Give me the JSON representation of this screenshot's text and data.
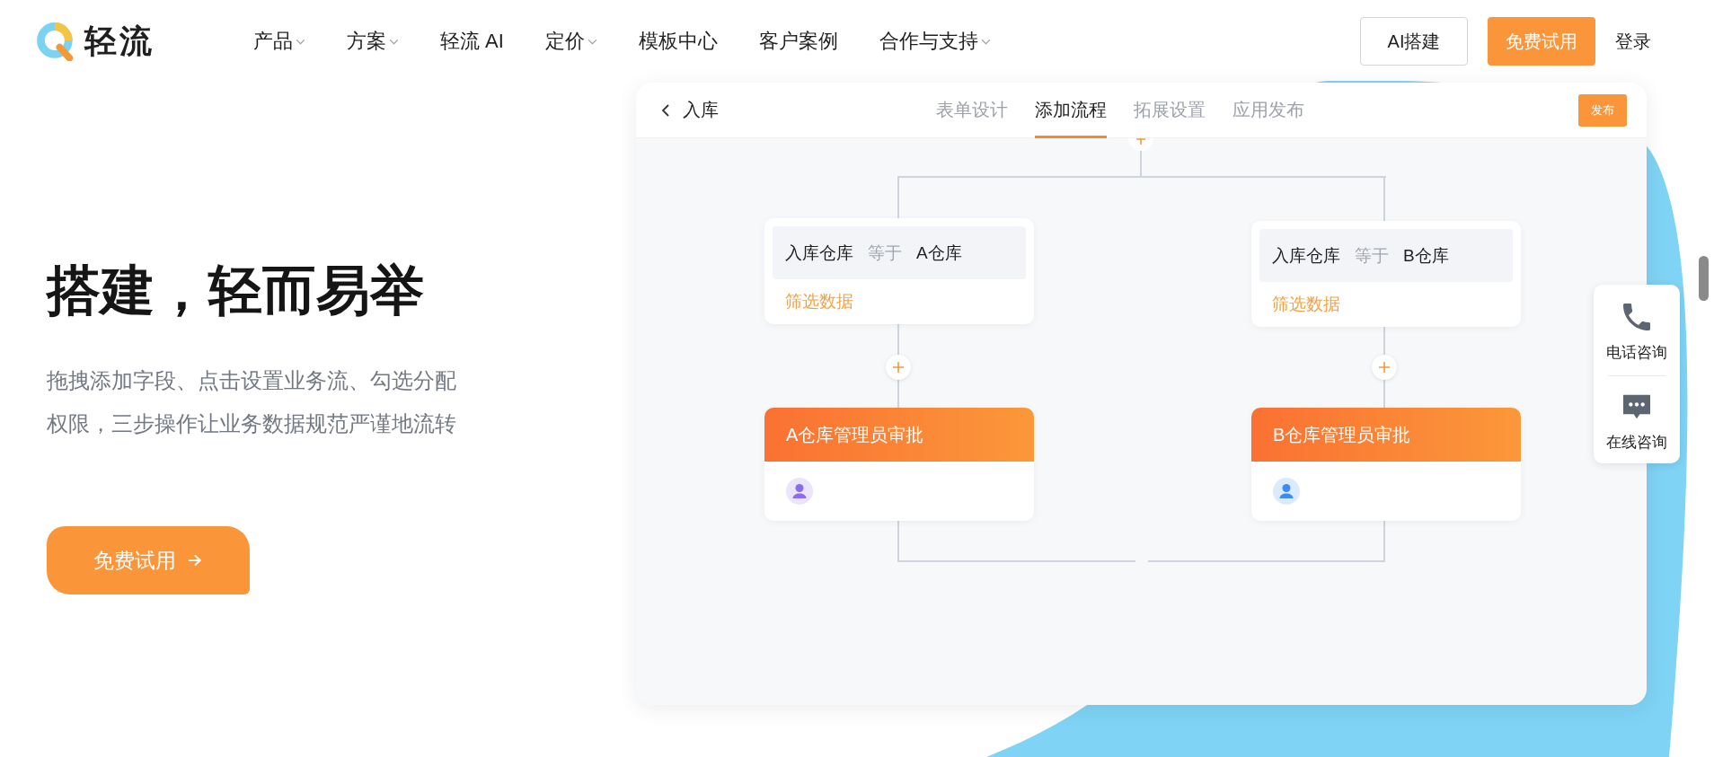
{
  "nav": {
    "logo": "轻流",
    "items": [
      {
        "label": "产品",
        "dropdown": true
      },
      {
        "label": "方案",
        "dropdown": true
      },
      {
        "label": "轻流 AI",
        "dropdown": false
      },
      {
        "label": "定价",
        "dropdown": true
      },
      {
        "label": "模板中心",
        "dropdown": false
      },
      {
        "label": "客户案例",
        "dropdown": false
      },
      {
        "label": "合作与支持",
        "dropdown": true
      }
    ],
    "ai_button": "AI搭建",
    "trial_button": "免费试用",
    "login": "登录"
  },
  "hero": {
    "title": "搭建，轻而易举",
    "description": "拖拽添加字段、点击设置业务流、勾选分配权限，三步操作让业务数据规范严谨地流转",
    "cta": "免费试用"
  },
  "app": {
    "back_title": "入库",
    "tabs": [
      {
        "label": "表单设计",
        "selected": false
      },
      {
        "label": "添加流程",
        "selected": true
      },
      {
        "label": "拓展设置",
        "selected": false
      },
      {
        "label": "应用发布",
        "selected": false
      }
    ],
    "publish": "发布",
    "branches": [
      {
        "field": "入库仓库",
        "operator": "等于",
        "value": "A仓库",
        "filter_link": "筛选数据",
        "approval": "A仓库管理员审批",
        "color": "#8b6cf0"
      },
      {
        "field": "入库仓库",
        "operator": "等于",
        "value": "B仓库",
        "filter_link": "筛选数据",
        "approval": "B仓库管理员审批",
        "color": "#3b8df5"
      }
    ]
  },
  "side_widget": {
    "items": [
      {
        "kind": "phone",
        "label": "电话咨询"
      },
      {
        "kind": "chat",
        "label": "在线咨询"
      }
    ]
  }
}
